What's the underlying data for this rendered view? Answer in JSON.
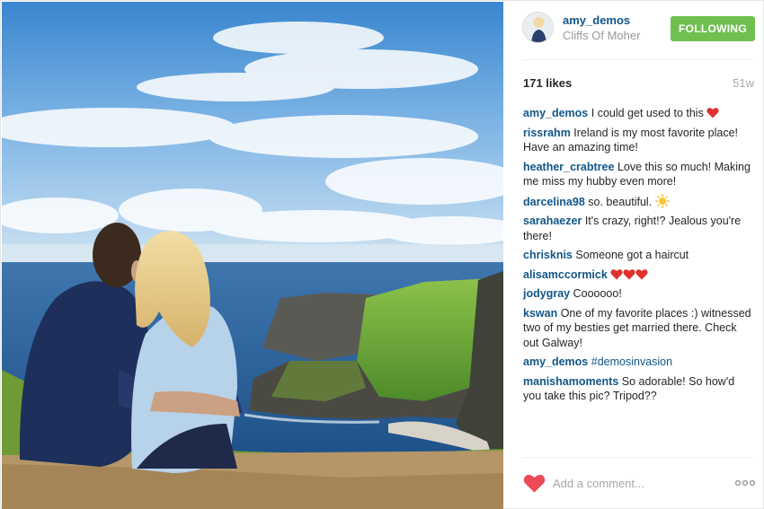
{
  "header": {
    "username": "amy_demos",
    "location": "Cliffs Of Moher",
    "follow_label": "FOLLOWING"
  },
  "stats": {
    "likes": "171 likes",
    "time_ago": "51w"
  },
  "comments": [
    {
      "user": "amy_demos",
      "text": "I could get used to this",
      "emoji": "red-heart-icon"
    },
    {
      "user": "rissrahm",
      "text": "Ireland is my most favorite place! Have an amazing time!"
    },
    {
      "user": "heather_crabtree",
      "text": "Love this so much! Making me miss my hubby even more!"
    },
    {
      "user": "darcelina98",
      "text": "so. beautiful.",
      "emoji": "sun-icon"
    },
    {
      "user": "sarahaezer",
      "text": "It's crazy, right!? Jealous you're there!"
    },
    {
      "user": "chrisknis",
      "text": "Someone got a haircut"
    },
    {
      "user": "alisamccormick",
      "text": "",
      "emoji": "three-red-hearts-icon"
    },
    {
      "user": "jodygray",
      "text": "Coooooo!"
    },
    {
      "user": "kswan",
      "text": "One of my favorite places :) witnessed two of my besties get married there. Check out Galway!"
    },
    {
      "user": "amy_demos",
      "hashtag": "#demosinvasion"
    },
    {
      "user": "manishamoments",
      "text": "So adorable! So how'd you take this pic? Tripod??"
    }
  ],
  "footer": {
    "comment_placeholder": "Add a comment...",
    "like_icon": "heart-icon",
    "more_icon": "more-options-icon"
  },
  "colors": {
    "username": "#125688",
    "follow_button": "#70c050",
    "like_heart": "#ed4956",
    "muted_text": "#a5a7aa"
  }
}
